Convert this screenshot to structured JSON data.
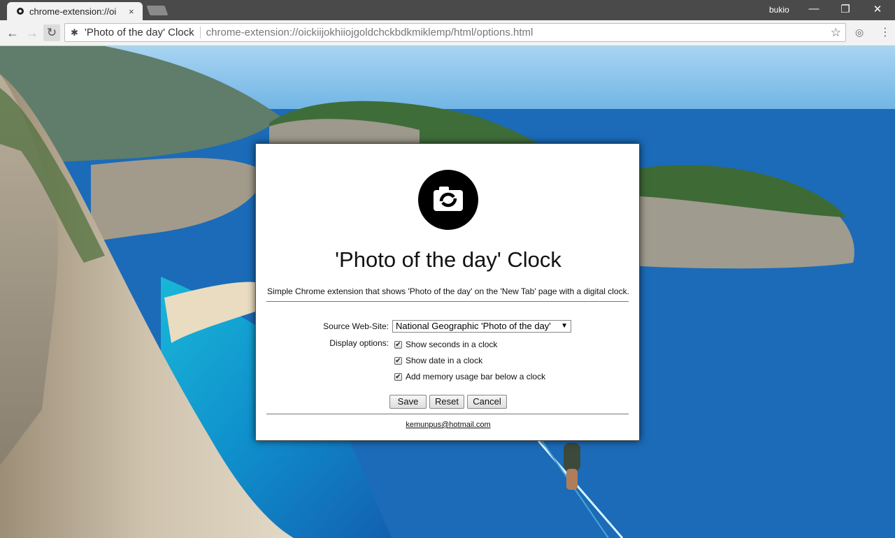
{
  "browser": {
    "tab_title": "chrome-extension://oi",
    "tab_close": "×",
    "profile_name": "bukio",
    "window_controls": {
      "minimize": "—",
      "restore": "❐",
      "close": "✕"
    },
    "nav": {
      "back": "←",
      "forward": "→",
      "reload": "↻"
    },
    "omnibox": {
      "ext_icon": "✱",
      "site_name": "'Photo of the day' Clock",
      "url": "chrome-extension://oickiijokhiiojgoldchckbdkmiklemp/html/options.html",
      "star": "☆"
    },
    "toolbar_icons": {
      "extension": "◎",
      "menu": "⋮"
    }
  },
  "dialog": {
    "title": "'Photo of the day' Clock",
    "description": "Simple Chrome extension that shows 'Photo of the day' on the 'New Tab' page with a digital clock.",
    "source_label": "Source Web-Site:",
    "source_value": "National Geographic 'Photo of the day'",
    "select_arrow": "▼",
    "display_label": "Display options:",
    "check_mark": "✔",
    "options": [
      {
        "label": "Show seconds in a clock",
        "checked": true
      },
      {
        "label": "Show date in a clock",
        "checked": true
      },
      {
        "label": "Add memory usage bar below a clock",
        "checked": true
      }
    ],
    "buttons": {
      "save": "Save",
      "reset": "Reset",
      "cancel": "Cancel"
    },
    "email": "kemunpus@hotmail.com"
  },
  "colors": {
    "dialog_bg": "#ffffff",
    "titlebar": "#4a4a4a",
    "toolbar": "#f2f2f2",
    "sea": "#1a62b0",
    "logo": "#000000"
  },
  "icons": [
    "favicon-icon",
    "back-arrow-icon",
    "forward-arrow-icon",
    "reload-icon",
    "extension-puzzle-icon",
    "star-icon",
    "camera-icon",
    "menu-icon"
  ]
}
